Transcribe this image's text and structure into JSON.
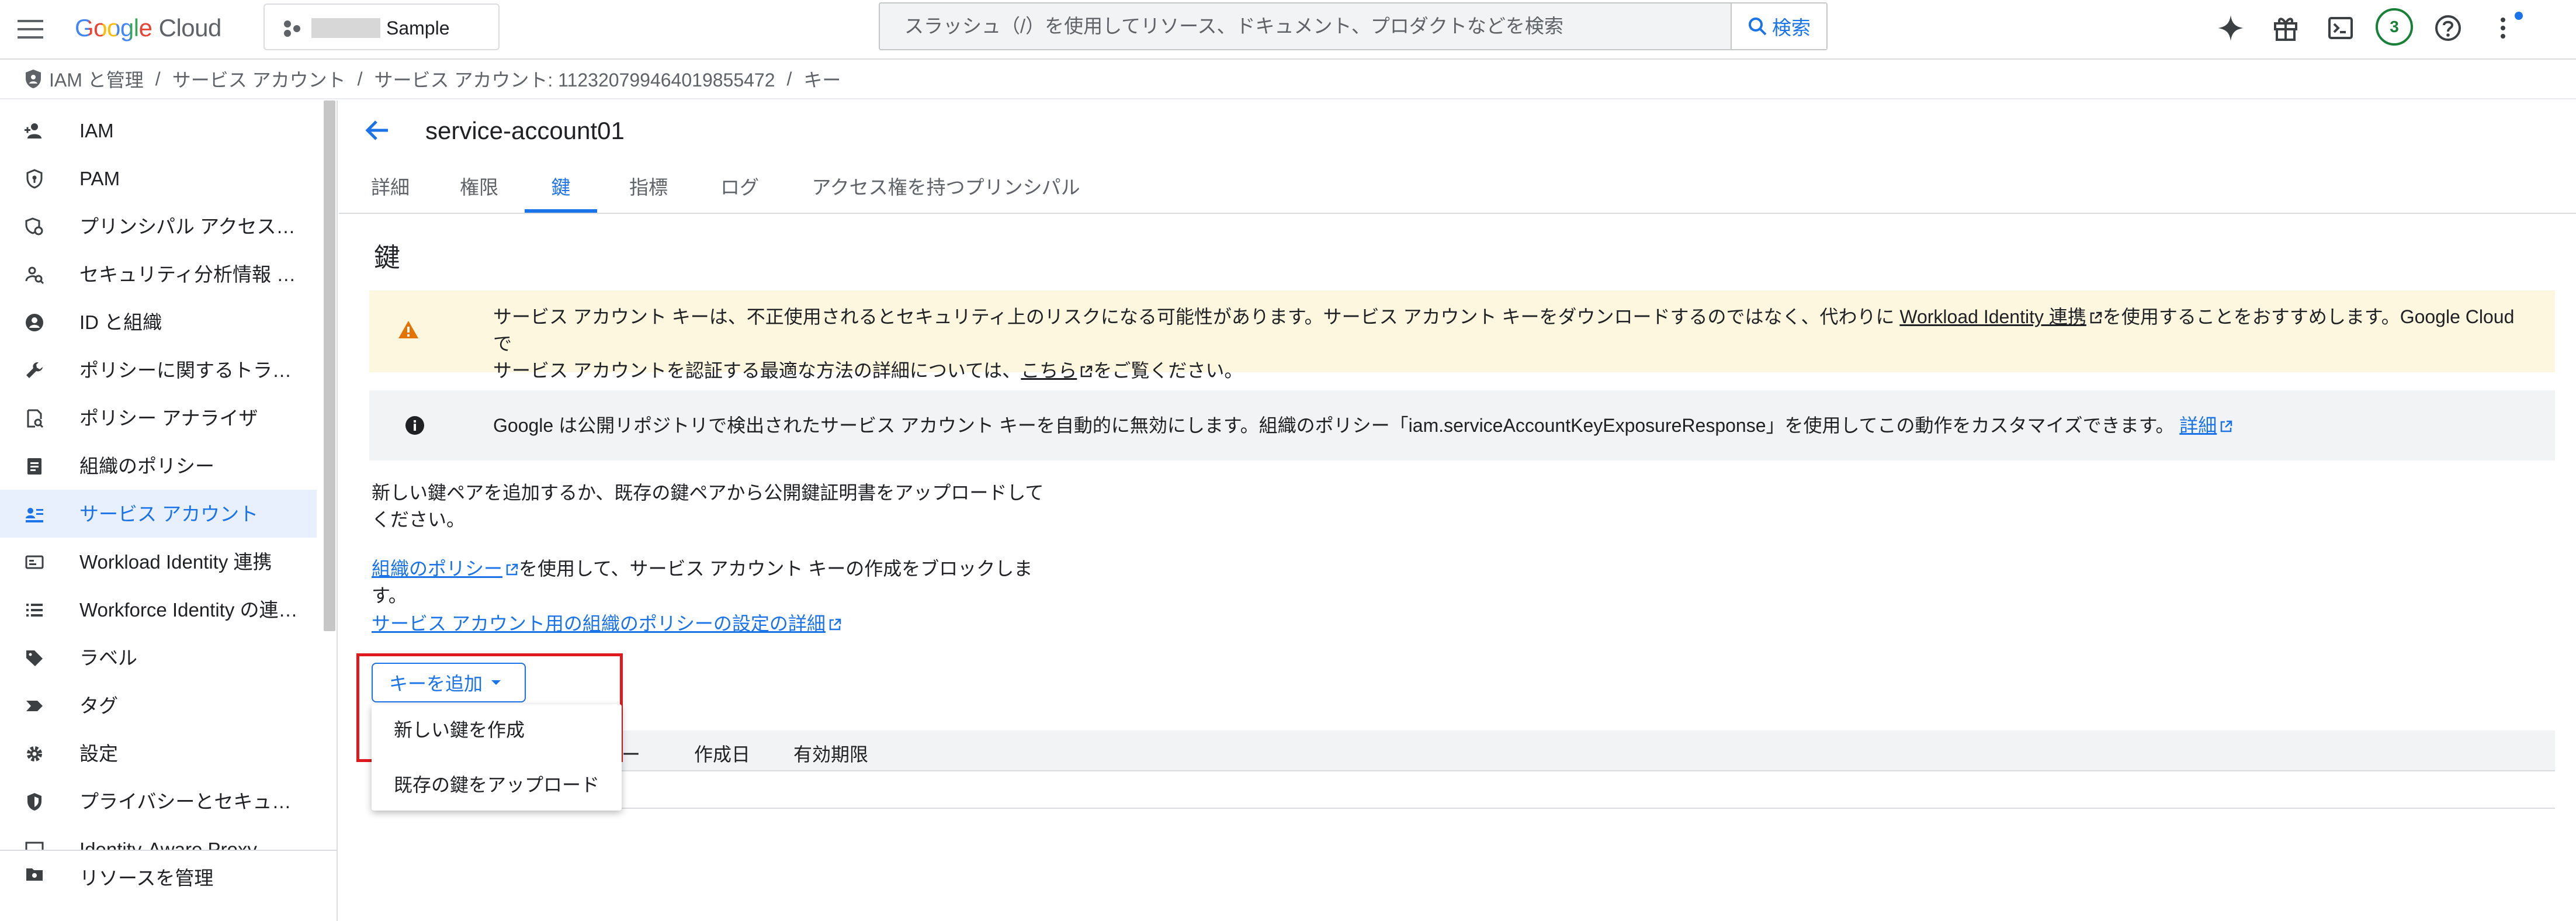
{
  "topbar": {
    "logo_google": "Google",
    "logo_cloud": "Cloud",
    "project_name": "Sample",
    "search_placeholder": "スラッシュ（/）を使用してリソース、ドキュメント、プロダクトなどを検索",
    "search_button": "検索",
    "notification_count": "3",
    "accent_color": "#1a73e8"
  },
  "breadcrumb": [
    "IAM と管理",
    "サービス アカウント",
    "サービス アカウント: 112320799464019855472",
    "キー"
  ],
  "sidebar": {
    "items": [
      {
        "label": "IAM",
        "icon": "person-add-icon"
      },
      {
        "label": "PAM",
        "icon": "shield-key-icon"
      },
      {
        "label": "プリンシパル アクセス…",
        "icon": "principal-access-icon"
      },
      {
        "label": "セキュリティ分析情報 …",
        "icon": "person-search-icon"
      },
      {
        "label": "ID と組織",
        "icon": "account-circle-icon"
      },
      {
        "label": "ポリシーに関するトラ…",
        "icon": "wrench-icon"
      },
      {
        "label": "ポリシー アナライザ",
        "icon": "policy-analyzer-icon"
      },
      {
        "label": "組織のポリシー",
        "icon": "document-icon"
      },
      {
        "label": "サービス アカウント",
        "icon": "service-account-icon"
      },
      {
        "label": "Workload Identity 連携",
        "icon": "id-card-icon"
      },
      {
        "label": "Workforce Identity の連…",
        "icon": "list-icon"
      },
      {
        "label": "ラベル",
        "icon": "label-icon"
      },
      {
        "label": "タグ",
        "icon": "tag-icon"
      },
      {
        "label": "設定",
        "icon": "gear-icon"
      },
      {
        "label": "プライバシーとセキュ…",
        "icon": "shield-icon"
      },
      {
        "label": "Identity-Aware Proxy",
        "icon": "proxy-icon"
      }
    ],
    "active_index": 8,
    "manage_resources": "リソースを管理"
  },
  "main": {
    "title": "service-account01",
    "tabs": [
      "詳細",
      "権限",
      "鍵",
      "指標",
      "ログ",
      "アクセス権を持つプリンシパル"
    ],
    "active_tab": 2,
    "section_title": "鍵",
    "warning": {
      "part1": "サービス アカウント キーは、不正使用されるとセキュリティ上のリスクになる可能性があります。サービス アカウント キーをダウンロードするのではなく、代わりに ",
      "link1": "Workload Identity 連携",
      "part2": "を使用することをおすすめします。Google Cloud で",
      "line2_part1": "サービス アカウントを認証する最適な方法の詳細については、",
      "link2": "こちら",
      "line2_part2": "をご覧ください。"
    },
    "info": {
      "text": "Google は公開リポジトリで検出されたサービス アカウント キーを自動的に無効にします。組織のポリシー「iam.serviceAccountKeyExposureResponse」を使用してこの動作をカスタマイズできます。",
      "link": "詳細"
    },
    "description": "新しい鍵ペアを追加するか、既存の鍵ペアから公開鍵証明書をアップロードしてください。",
    "org_policy_link": "組織のポリシー",
    "org_policy_text": "を使用して、サービス アカウント キーの作成をブロックします。",
    "org_policy_detail_link": "サービス アカウント用の組織のポリシーの設定の詳細",
    "add_key_button": "キーを追加",
    "table_headers": [
      "キー",
      "作成日",
      "有効期限"
    ],
    "table_header_partial": "ー",
    "menu_items": [
      "新しい鍵を作成",
      "既存の鍵をアップロード"
    ]
  }
}
